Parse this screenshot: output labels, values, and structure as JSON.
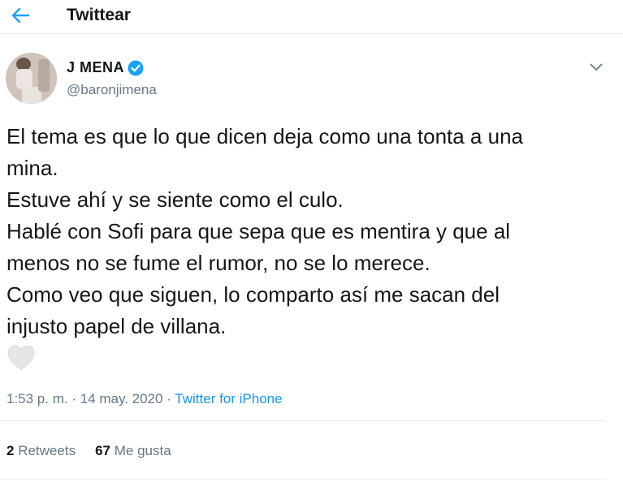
{
  "header": {
    "title": "Twittear",
    "back_icon": "back-arrow-icon",
    "accent": "#1da1f2"
  },
  "tweet": {
    "author": {
      "display_name": "J MENA",
      "username": "@baronjimena",
      "verified_icon": "verified-badge-icon",
      "verified_color": "#1da1f2"
    },
    "lines": [
      "El tema es que lo que dicen deja como una tonta a una",
      "mina.",
      "Estuve ahí y se siente como el culo.",
      "Hablé con Sofi para que sepa que es mentira y que al",
      "menos no se fume el rumor, no se lo merece.",
      "Como veo que siguen, lo comparto así me sacan del",
      "injusto papel de villana."
    ],
    "meta": {
      "time": "1:53 p. m.",
      "separator": " · ",
      "date": "14 may. 2020",
      "source": "Twitter for iPhone"
    },
    "stats": {
      "retweets_count": "2",
      "retweets_label": "Retweets",
      "likes_count": "67",
      "likes_label": "Me gusta"
    }
  }
}
